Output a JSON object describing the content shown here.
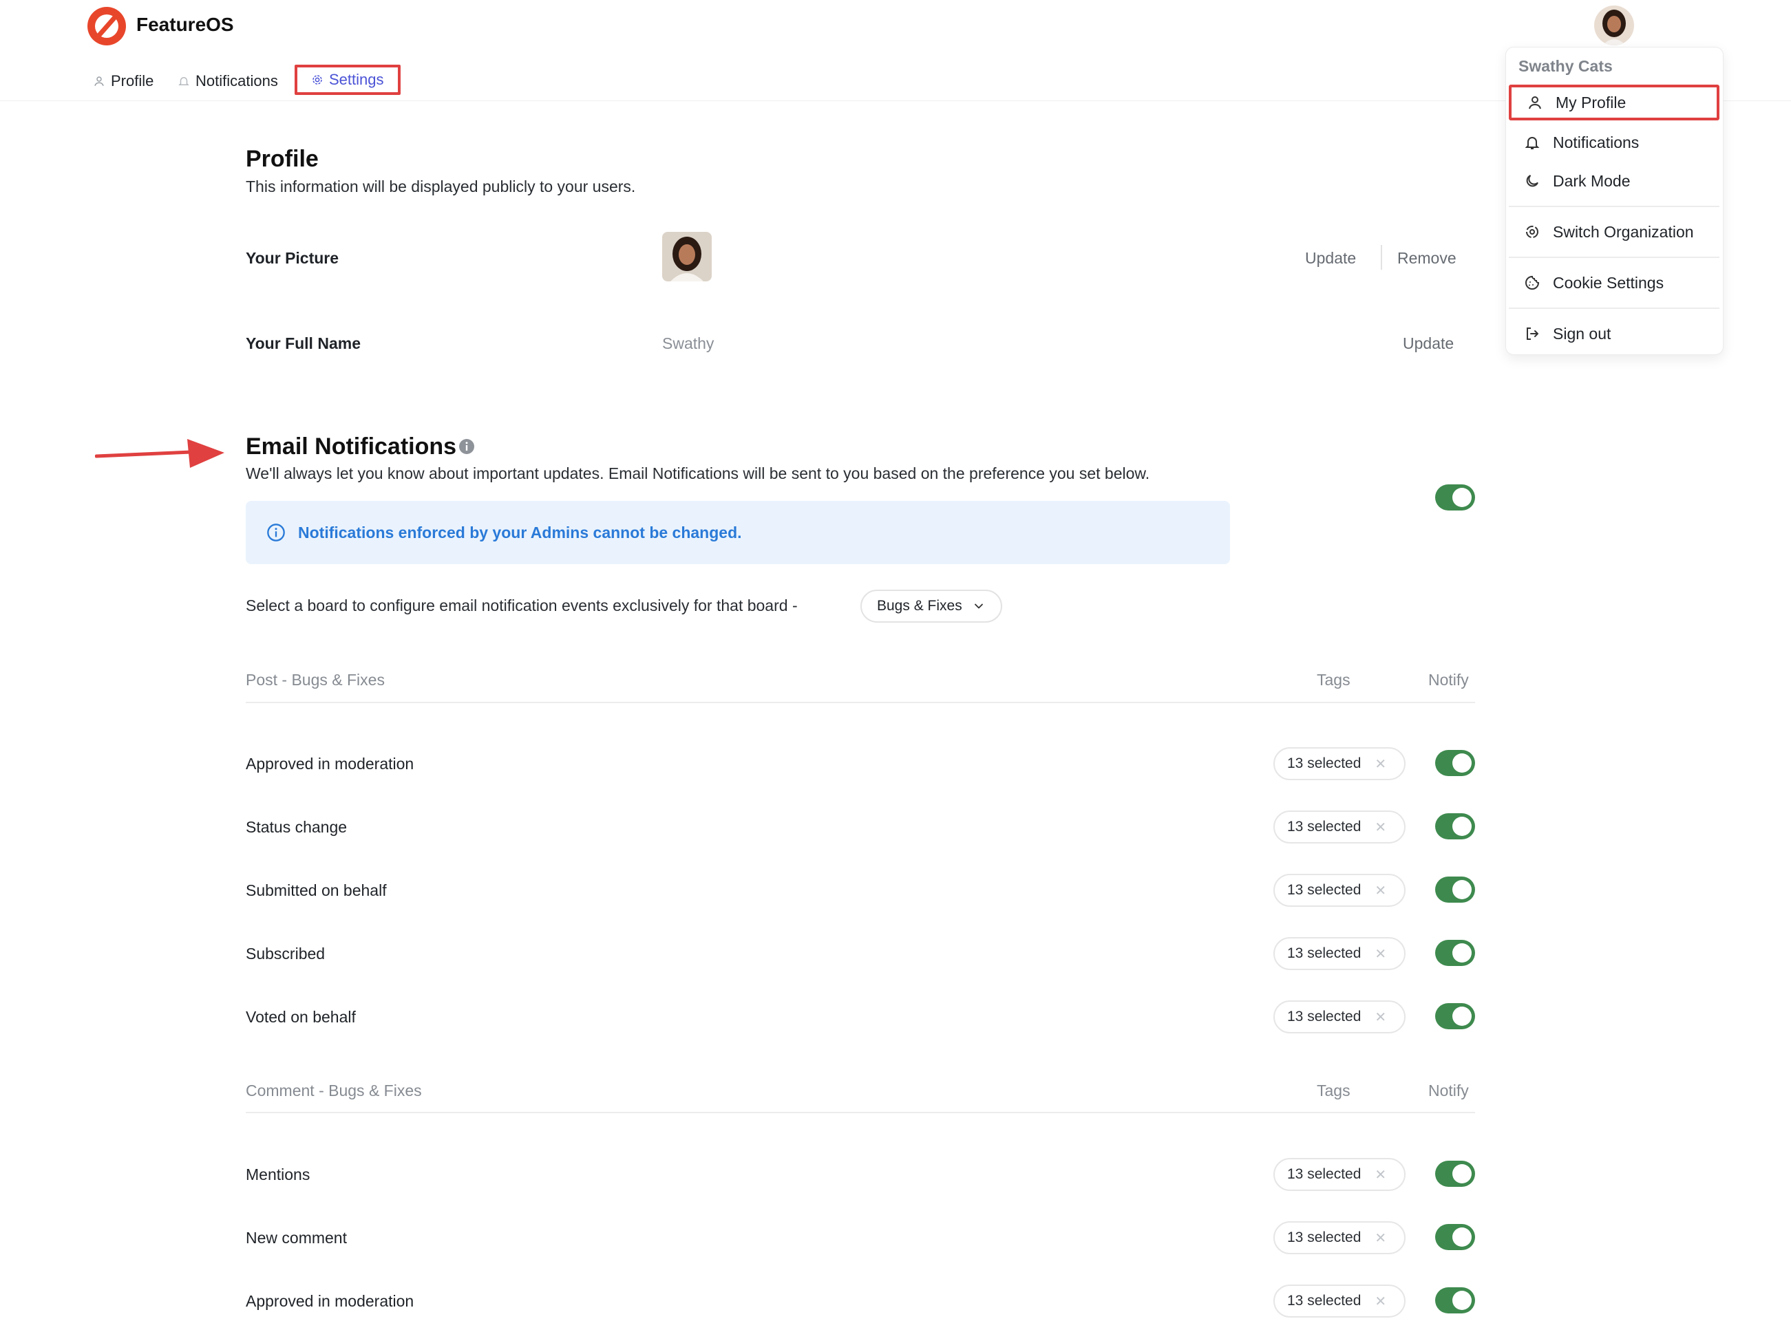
{
  "header": {
    "app_title": "FeatureOS",
    "tabs": [
      {
        "label": "Profile",
        "icon": "user-icon"
      },
      {
        "label": "Notifications",
        "icon": "bell-icon"
      },
      {
        "label": "Settings",
        "icon": "gear-icon"
      }
    ]
  },
  "profile": {
    "title": "Profile",
    "subtitle": "This information will be displayed publicly to your users.",
    "picture_label": "Your Picture",
    "update_label": "Update",
    "remove_label": "Remove",
    "full_name_label": "Your Full Name",
    "full_name_value": "Swathy",
    "name_update_label": "Update"
  },
  "email_notifications": {
    "title": "Email Notifications",
    "subtitle": "We'll always let you know about important updates. Email Notifications will be sent to you based on the preference you set below.",
    "master_toggle_on": true,
    "info_text": "Notifications enforced by your Admins cannot be changed.",
    "board_prompt": "Select a board to configure email notification events exclusively for that board -",
    "board_selected": "Bugs & Fixes",
    "post_section": {
      "header": "Post - Bugs & Fixes",
      "tags_header": "Tags",
      "notify_header": "Notify",
      "rows": [
        {
          "label": "Approved in moderation",
          "tags": "13 selected",
          "notify": true
        },
        {
          "label": "Status change",
          "tags": "13 selected",
          "notify": true
        },
        {
          "label": "Submitted on behalf",
          "tags": "13 selected",
          "notify": true
        },
        {
          "label": "Subscribed",
          "tags": "13 selected",
          "notify": true
        },
        {
          "label": "Voted on behalf",
          "tags": "13 selected",
          "notify": true
        }
      ]
    },
    "comment_section": {
      "header": "Comment - Bugs & Fixes",
      "tags_header": "Tags",
      "notify_header": "Notify",
      "rows": [
        {
          "label": "Mentions",
          "tags": "13 selected",
          "notify": true
        },
        {
          "label": "New comment",
          "tags": "13 selected",
          "notify": true
        },
        {
          "label": "Approved in moderation",
          "tags": "13 selected",
          "notify": true
        }
      ]
    }
  },
  "user_menu": {
    "org_name": "Swathy Cats",
    "items": [
      {
        "label": "My Profile",
        "icon": "user-icon"
      },
      {
        "label": "Notifications",
        "icon": "bell-icon"
      },
      {
        "label": "Dark Mode",
        "icon": "moon-icon"
      },
      {
        "label": "Switch Organization",
        "icon": "switch-org-icon"
      },
      {
        "label": "Cookie Settings",
        "icon": "cookie-icon"
      },
      {
        "label": "Sign out",
        "icon": "sign-out-icon"
      }
    ]
  },
  "colors": {
    "accent": "#4b53d6",
    "toggle_on": "#3e8a4e",
    "highlight": "#e04040",
    "info_bg": "#eaf3fd",
    "info_text": "#2a7ad8"
  }
}
